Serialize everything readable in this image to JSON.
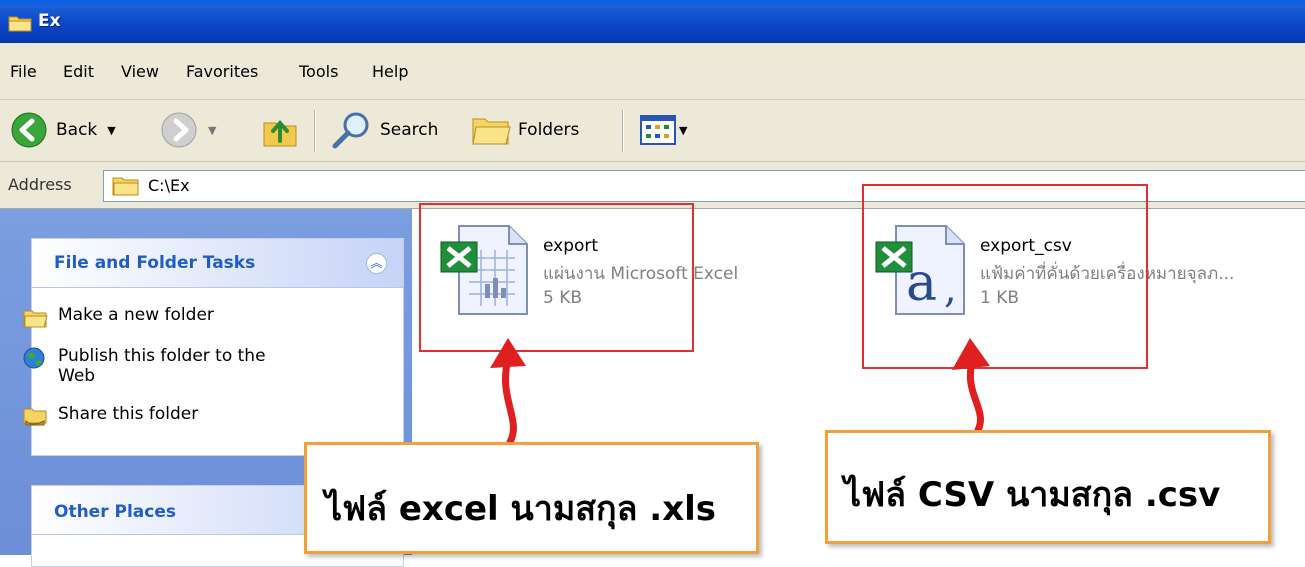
{
  "window": {
    "title": "Ex"
  },
  "menu": [
    "File",
    "Edit",
    "View",
    "Favorites",
    "Tools",
    "Help"
  ],
  "toolbar": {
    "back_label": "Back",
    "search_label": "Search",
    "folders_label": "Folders"
  },
  "address": {
    "label": "Address",
    "value": "C:\\Ex"
  },
  "tasks_panel": {
    "title": "File and Folder Tasks",
    "items": [
      {
        "label": "Make a new folder"
      },
      {
        "label": "Publish this folder to the Web"
      },
      {
        "label": "Share this folder"
      }
    ]
  },
  "other_places": {
    "title": "Other Places"
  },
  "files": [
    {
      "name": "export",
      "type": "แผ่นงาน Microsoft Excel",
      "size": "5 KB"
    },
    {
      "name": "export_csv",
      "type": "แฟ้มค่าที่คั่นด้วยเครื่องหมายจุลภ...",
      "size": "1 KB"
    }
  ],
  "callouts": {
    "xls": "ไฟล์ excel นามสกุล .xls",
    "csv": "ไฟล์ CSV นามสกุล .csv"
  },
  "colors": {
    "title_blue": "#0a47c9",
    "red_highlight": "#e03030",
    "orange_callout": "#f2a13a",
    "panel_bg": "#7b9ee0"
  }
}
